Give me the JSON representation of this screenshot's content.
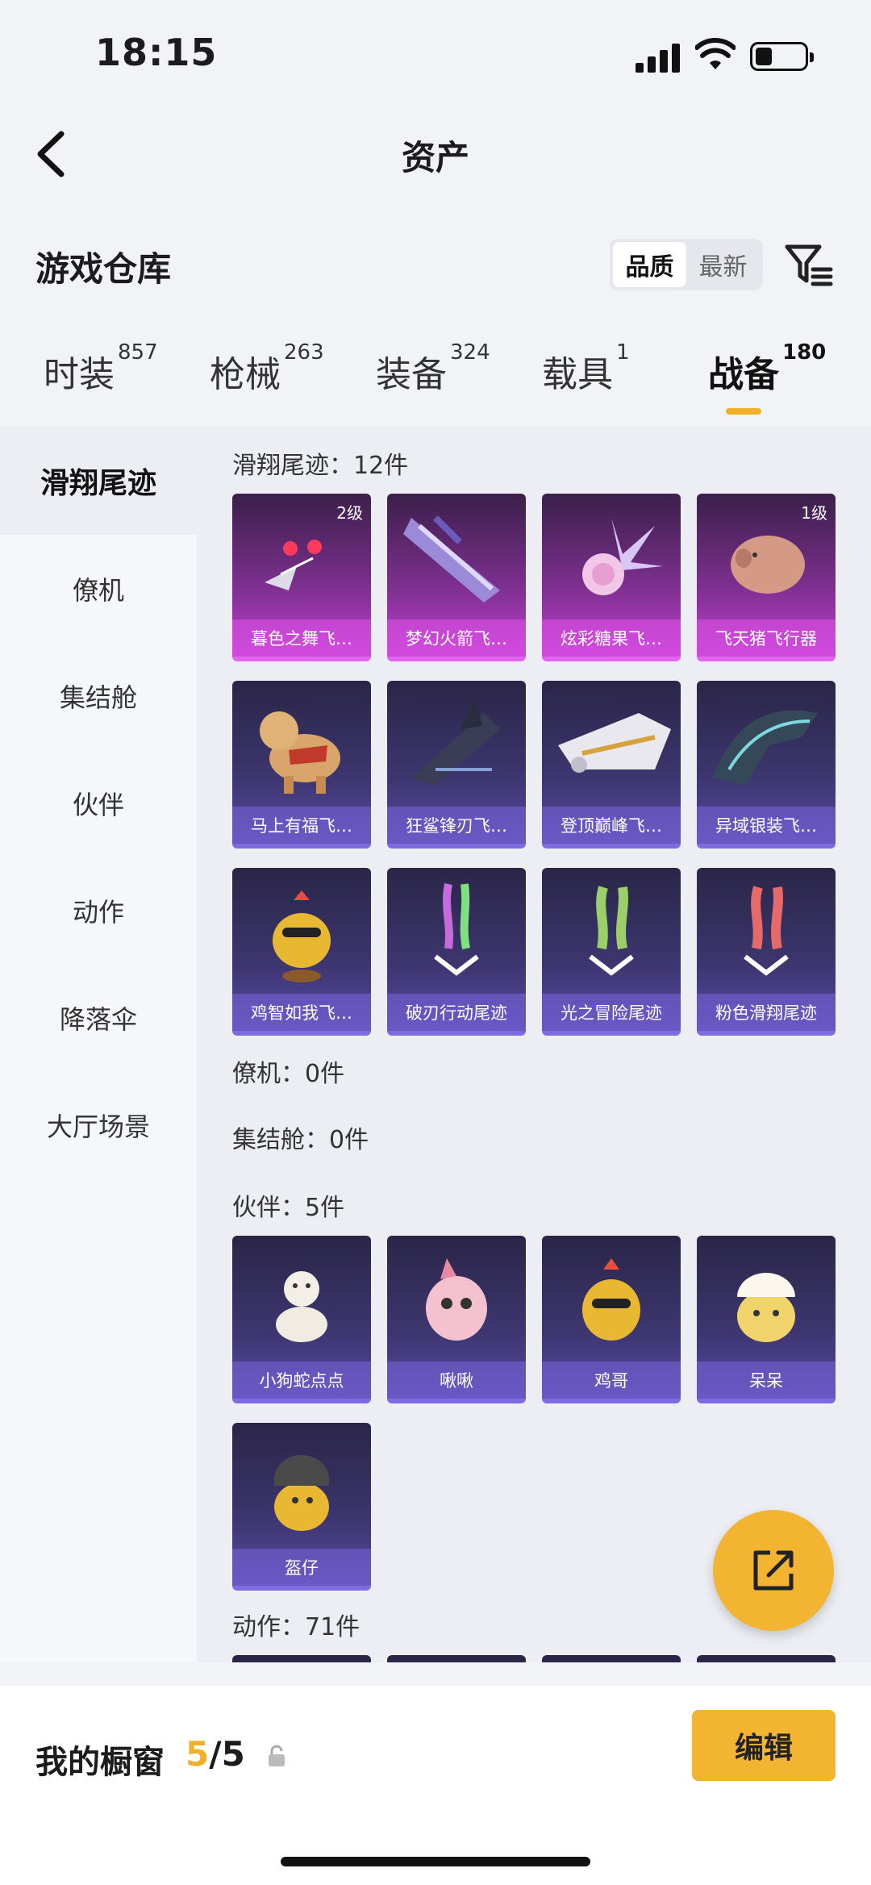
{
  "status": {
    "time": "18:15"
  },
  "nav": {
    "title": "资产"
  },
  "warehouse": {
    "title": "游戏仓库",
    "sort_options": [
      "品质",
      "最新"
    ],
    "active_sort": "品质"
  },
  "tabs": [
    {
      "label": "时装",
      "count": "857"
    },
    {
      "label": "枪械",
      "count": "263"
    },
    {
      "label": "装备",
      "count": "324"
    },
    {
      "label": "载具",
      "count": "1"
    },
    {
      "label": "战备",
      "count": "180"
    }
  ],
  "sidebar": [
    {
      "label": "滑翔尾迹"
    },
    {
      "label": "僚机"
    },
    {
      "label": "集结舱"
    },
    {
      "label": "伙伴"
    },
    {
      "label": "动作"
    },
    {
      "label": "降落伞"
    },
    {
      "label": "大厅场景"
    }
  ],
  "sections": {
    "trails": {
      "title": "滑翔尾迹：12件",
      "items": [
        {
          "name": "暮色之舞飞…",
          "level": "2级"
        },
        {
          "name": "梦幻火箭飞…",
          "level": ""
        },
        {
          "name": "炫彩糖果飞…",
          "level": ""
        },
        {
          "name": "飞天猪飞行器",
          "level": "1级"
        },
        {
          "name": "马上有福飞…",
          "level": ""
        },
        {
          "name": "狂鲨锋刃飞…",
          "level": ""
        },
        {
          "name": "登顶巅峰飞…",
          "level": ""
        },
        {
          "name": "异域银装飞…",
          "level": ""
        },
        {
          "name": "鸡智如我飞…",
          "level": ""
        },
        {
          "name": "破刃行动尾迹",
          "level": ""
        },
        {
          "name": "光之冒险尾迹",
          "level": ""
        },
        {
          "name": "粉色滑翔尾迹",
          "level": ""
        }
      ]
    },
    "wingman": {
      "title": "僚机：0件"
    },
    "pod": {
      "title": "集结舱：0件"
    },
    "partners": {
      "title": "伙伴：5件",
      "items": [
        {
          "name": "小狗蛇点点"
        },
        {
          "name": "啾啾"
        },
        {
          "name": "鸡哥"
        },
        {
          "name": "呆呆"
        },
        {
          "name": "盔仔"
        }
      ]
    },
    "emotes": {
      "title": "动作：71件"
    }
  },
  "bottom": {
    "label": "我的橱窗",
    "count_current": "5",
    "count_total": "/5",
    "edit_label": "编辑"
  },
  "colors": {
    "accent": "#f2b431",
    "card_purple": "#3d3670",
    "card_pink": "#c23fd1"
  }
}
